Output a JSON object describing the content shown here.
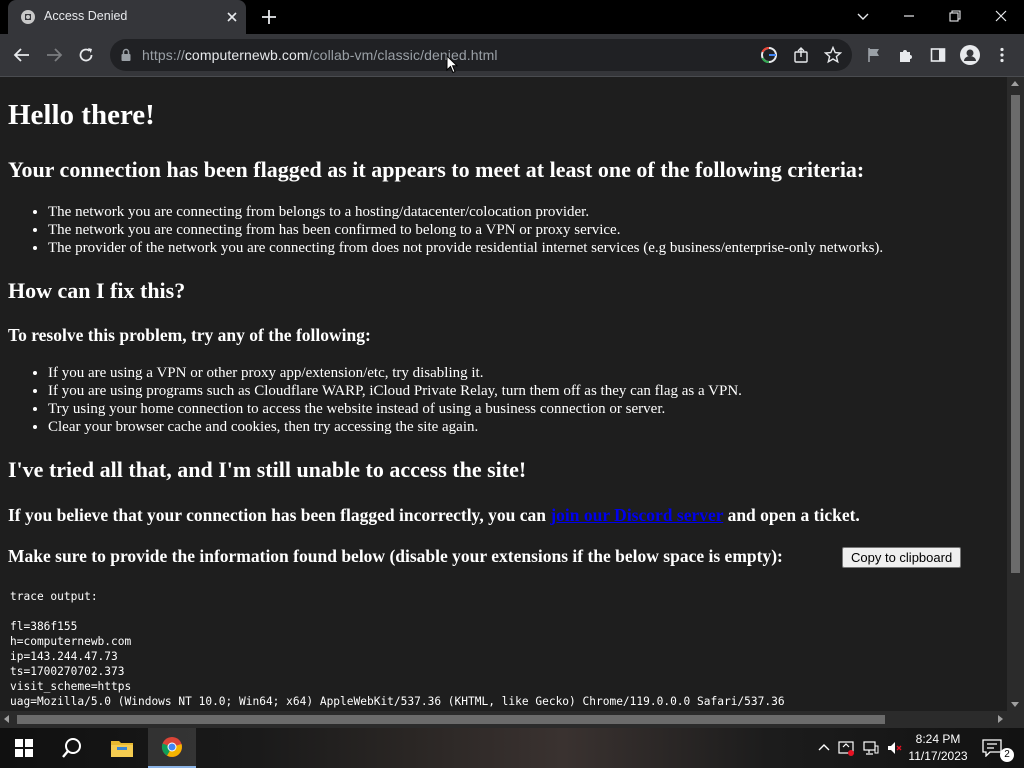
{
  "browser": {
    "tab_title": "Access Denied",
    "url_host": "computernewb.com",
    "url_scheme": "https://",
    "url_path": "/collab-vm/classic/denied.html"
  },
  "page": {
    "hello": "Hello there!",
    "flagged_heading": "Your connection has been flagged as it appears to meet at least one of the following criteria:",
    "criteria": [
      "The network you are connecting from belongs to a hosting/datacenter/colocation provider.",
      "The network you are connecting from has been confirmed to belong to a VPN or proxy service.",
      "The provider of the network you are connecting from does not provide residential internet services (e.g business/enterprise-only networks)."
    ],
    "fix_heading": "How can I fix this?",
    "resolve_heading": "To resolve this problem, try any of the following:",
    "fixes": [
      "If you are using a VPN or other proxy app/extension/etc, try disabling it.",
      "If you are using programs such as Cloudflare WARP, iCloud Private Relay, turn them off as they can flag as a VPN.",
      "Try using your home connection to access the website instead of using a business connection or server.",
      "Clear your browser cache and cookies, then try accessing the site again."
    ],
    "tried_heading": "I've tried all that, and I'm still unable to access the site!",
    "incorrect_before": "If you believe that your connection has been flagged incorrectly, you can ",
    "discord_link": "join our Discord server",
    "incorrect_after": " and open a ticket.",
    "provide_info": "Make sure to provide the information found below (disable your extensions if the below space is empty):",
    "copy_button": "Copy to clipboard",
    "trace_output": "trace output:\n\nfl=386f155\nh=computernewb.com\nip=143.244.47.73\nts=1700270702.373\nvisit_scheme=https\nuag=Mozilla/5.0 (Windows NT 10.0; Win64; x64) AppleWebKit/537.36 (KHTML, like Gecko) Chrome/119.0.0.0 Safari/537.36"
  },
  "taskbar": {
    "time": "8:24 PM",
    "date": "11/17/2023",
    "notification_count": "2"
  },
  "colors": {
    "page_bg": "#1e1e1e",
    "link": "#0000ee",
    "toolbar": "#35363a",
    "tabstrip": "#000000"
  }
}
